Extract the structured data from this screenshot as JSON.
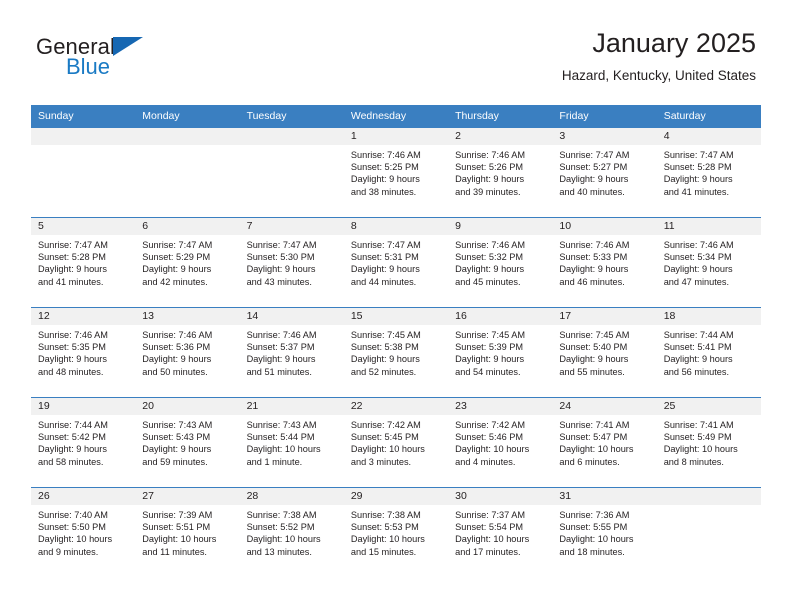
{
  "brand": {
    "line1": "General",
    "line2": "Blue",
    "flag_icon": "triangle-flag-icon",
    "accent_color": "#1a7ac4"
  },
  "header": {
    "title": "January 2025",
    "subtitle": "Hazard, Kentucky, United States"
  },
  "colors": {
    "header_row_bg": "#3a7fc1",
    "daynum_strip_bg": "#f1f1f1",
    "row_border": "#3a7fc1",
    "text": "#231f20"
  },
  "weekday_headers": [
    "Sunday",
    "Monday",
    "Tuesday",
    "Wednesday",
    "Thursday",
    "Friday",
    "Saturday"
  ],
  "weeks": [
    [
      {
        "day": "",
        "empty": true
      },
      {
        "day": "",
        "empty": true
      },
      {
        "day": "",
        "empty": true
      },
      {
        "day": "1",
        "sunrise": "Sunrise: 7:46 AM",
        "sunset": "Sunset: 5:25 PM",
        "daylight1": "Daylight: 9 hours",
        "daylight2": "and 38 minutes."
      },
      {
        "day": "2",
        "sunrise": "Sunrise: 7:46 AM",
        "sunset": "Sunset: 5:26 PM",
        "daylight1": "Daylight: 9 hours",
        "daylight2": "and 39 minutes."
      },
      {
        "day": "3",
        "sunrise": "Sunrise: 7:47 AM",
        "sunset": "Sunset: 5:27 PM",
        "daylight1": "Daylight: 9 hours",
        "daylight2": "and 40 minutes."
      },
      {
        "day": "4",
        "sunrise": "Sunrise: 7:47 AM",
        "sunset": "Sunset: 5:28 PM",
        "daylight1": "Daylight: 9 hours",
        "daylight2": "and 41 minutes."
      }
    ],
    [
      {
        "day": "5",
        "sunrise": "Sunrise: 7:47 AM",
        "sunset": "Sunset: 5:28 PM",
        "daylight1": "Daylight: 9 hours",
        "daylight2": "and 41 minutes."
      },
      {
        "day": "6",
        "sunrise": "Sunrise: 7:47 AM",
        "sunset": "Sunset: 5:29 PM",
        "daylight1": "Daylight: 9 hours",
        "daylight2": "and 42 minutes."
      },
      {
        "day": "7",
        "sunrise": "Sunrise: 7:47 AM",
        "sunset": "Sunset: 5:30 PM",
        "daylight1": "Daylight: 9 hours",
        "daylight2": "and 43 minutes."
      },
      {
        "day": "8",
        "sunrise": "Sunrise: 7:47 AM",
        "sunset": "Sunset: 5:31 PM",
        "daylight1": "Daylight: 9 hours",
        "daylight2": "and 44 minutes."
      },
      {
        "day": "9",
        "sunrise": "Sunrise: 7:46 AM",
        "sunset": "Sunset: 5:32 PM",
        "daylight1": "Daylight: 9 hours",
        "daylight2": "and 45 minutes."
      },
      {
        "day": "10",
        "sunrise": "Sunrise: 7:46 AM",
        "sunset": "Sunset: 5:33 PM",
        "daylight1": "Daylight: 9 hours",
        "daylight2": "and 46 minutes."
      },
      {
        "day": "11",
        "sunrise": "Sunrise: 7:46 AM",
        "sunset": "Sunset: 5:34 PM",
        "daylight1": "Daylight: 9 hours",
        "daylight2": "and 47 minutes."
      }
    ],
    [
      {
        "day": "12",
        "sunrise": "Sunrise: 7:46 AM",
        "sunset": "Sunset: 5:35 PM",
        "daylight1": "Daylight: 9 hours",
        "daylight2": "and 48 minutes."
      },
      {
        "day": "13",
        "sunrise": "Sunrise: 7:46 AM",
        "sunset": "Sunset: 5:36 PM",
        "daylight1": "Daylight: 9 hours",
        "daylight2": "and 50 minutes."
      },
      {
        "day": "14",
        "sunrise": "Sunrise: 7:46 AM",
        "sunset": "Sunset: 5:37 PM",
        "daylight1": "Daylight: 9 hours",
        "daylight2": "and 51 minutes."
      },
      {
        "day": "15",
        "sunrise": "Sunrise: 7:45 AM",
        "sunset": "Sunset: 5:38 PM",
        "daylight1": "Daylight: 9 hours",
        "daylight2": "and 52 minutes."
      },
      {
        "day": "16",
        "sunrise": "Sunrise: 7:45 AM",
        "sunset": "Sunset: 5:39 PM",
        "daylight1": "Daylight: 9 hours",
        "daylight2": "and 54 minutes."
      },
      {
        "day": "17",
        "sunrise": "Sunrise: 7:45 AM",
        "sunset": "Sunset: 5:40 PM",
        "daylight1": "Daylight: 9 hours",
        "daylight2": "and 55 minutes."
      },
      {
        "day": "18",
        "sunrise": "Sunrise: 7:44 AM",
        "sunset": "Sunset: 5:41 PM",
        "daylight1": "Daylight: 9 hours",
        "daylight2": "and 56 minutes."
      }
    ],
    [
      {
        "day": "19",
        "sunrise": "Sunrise: 7:44 AM",
        "sunset": "Sunset: 5:42 PM",
        "daylight1": "Daylight: 9 hours",
        "daylight2": "and 58 minutes."
      },
      {
        "day": "20",
        "sunrise": "Sunrise: 7:43 AM",
        "sunset": "Sunset: 5:43 PM",
        "daylight1": "Daylight: 9 hours",
        "daylight2": "and 59 minutes."
      },
      {
        "day": "21",
        "sunrise": "Sunrise: 7:43 AM",
        "sunset": "Sunset: 5:44 PM",
        "daylight1": "Daylight: 10 hours",
        "daylight2": "and 1 minute."
      },
      {
        "day": "22",
        "sunrise": "Sunrise: 7:42 AM",
        "sunset": "Sunset: 5:45 PM",
        "daylight1": "Daylight: 10 hours",
        "daylight2": "and 3 minutes."
      },
      {
        "day": "23",
        "sunrise": "Sunrise: 7:42 AM",
        "sunset": "Sunset: 5:46 PM",
        "daylight1": "Daylight: 10 hours",
        "daylight2": "and 4 minutes."
      },
      {
        "day": "24",
        "sunrise": "Sunrise: 7:41 AM",
        "sunset": "Sunset: 5:47 PM",
        "daylight1": "Daylight: 10 hours",
        "daylight2": "and 6 minutes."
      },
      {
        "day": "25",
        "sunrise": "Sunrise: 7:41 AM",
        "sunset": "Sunset: 5:49 PM",
        "daylight1": "Daylight: 10 hours",
        "daylight2": "and 8 minutes."
      }
    ],
    [
      {
        "day": "26",
        "sunrise": "Sunrise: 7:40 AM",
        "sunset": "Sunset: 5:50 PM",
        "daylight1": "Daylight: 10 hours",
        "daylight2": "and 9 minutes."
      },
      {
        "day": "27",
        "sunrise": "Sunrise: 7:39 AM",
        "sunset": "Sunset: 5:51 PM",
        "daylight1": "Daylight: 10 hours",
        "daylight2": "and 11 minutes."
      },
      {
        "day": "28",
        "sunrise": "Sunrise: 7:38 AM",
        "sunset": "Sunset: 5:52 PM",
        "daylight1": "Daylight: 10 hours",
        "daylight2": "and 13 minutes."
      },
      {
        "day": "29",
        "sunrise": "Sunrise: 7:38 AM",
        "sunset": "Sunset: 5:53 PM",
        "daylight1": "Daylight: 10 hours",
        "daylight2": "and 15 minutes."
      },
      {
        "day": "30",
        "sunrise": "Sunrise: 7:37 AM",
        "sunset": "Sunset: 5:54 PM",
        "daylight1": "Daylight: 10 hours",
        "daylight2": "and 17 minutes."
      },
      {
        "day": "31",
        "sunrise": "Sunrise: 7:36 AM",
        "sunset": "Sunset: 5:55 PM",
        "daylight1": "Daylight: 10 hours",
        "daylight2": "and 18 minutes."
      },
      {
        "day": "",
        "empty": true
      }
    ]
  ]
}
